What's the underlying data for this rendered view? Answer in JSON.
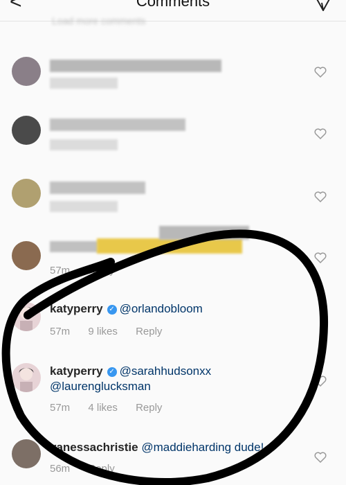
{
  "header": {
    "title": "Comments",
    "back_icon": "chevron-left-icon",
    "send_icon": "send-icon"
  },
  "load_more": "Load more comments",
  "comments": [
    {
      "user": "katyperry",
      "verified": true,
      "text": "@orlandobloom",
      "time": "57m",
      "likes": "9 likes",
      "reply": "Reply"
    },
    {
      "user": "katyperry",
      "verified": true,
      "text": "@sarahhudsonxx",
      "text2": "@laurenglucksman",
      "time": "57m",
      "likes": "4 likes",
      "reply": "Reply"
    },
    {
      "user": "vanessachristie",
      "text": "@maddieharding dude!",
      "time": "56m",
      "reply": "Reply"
    }
  ],
  "partial_meta": {
    "time": "57m",
    "reply": "Reply"
  }
}
